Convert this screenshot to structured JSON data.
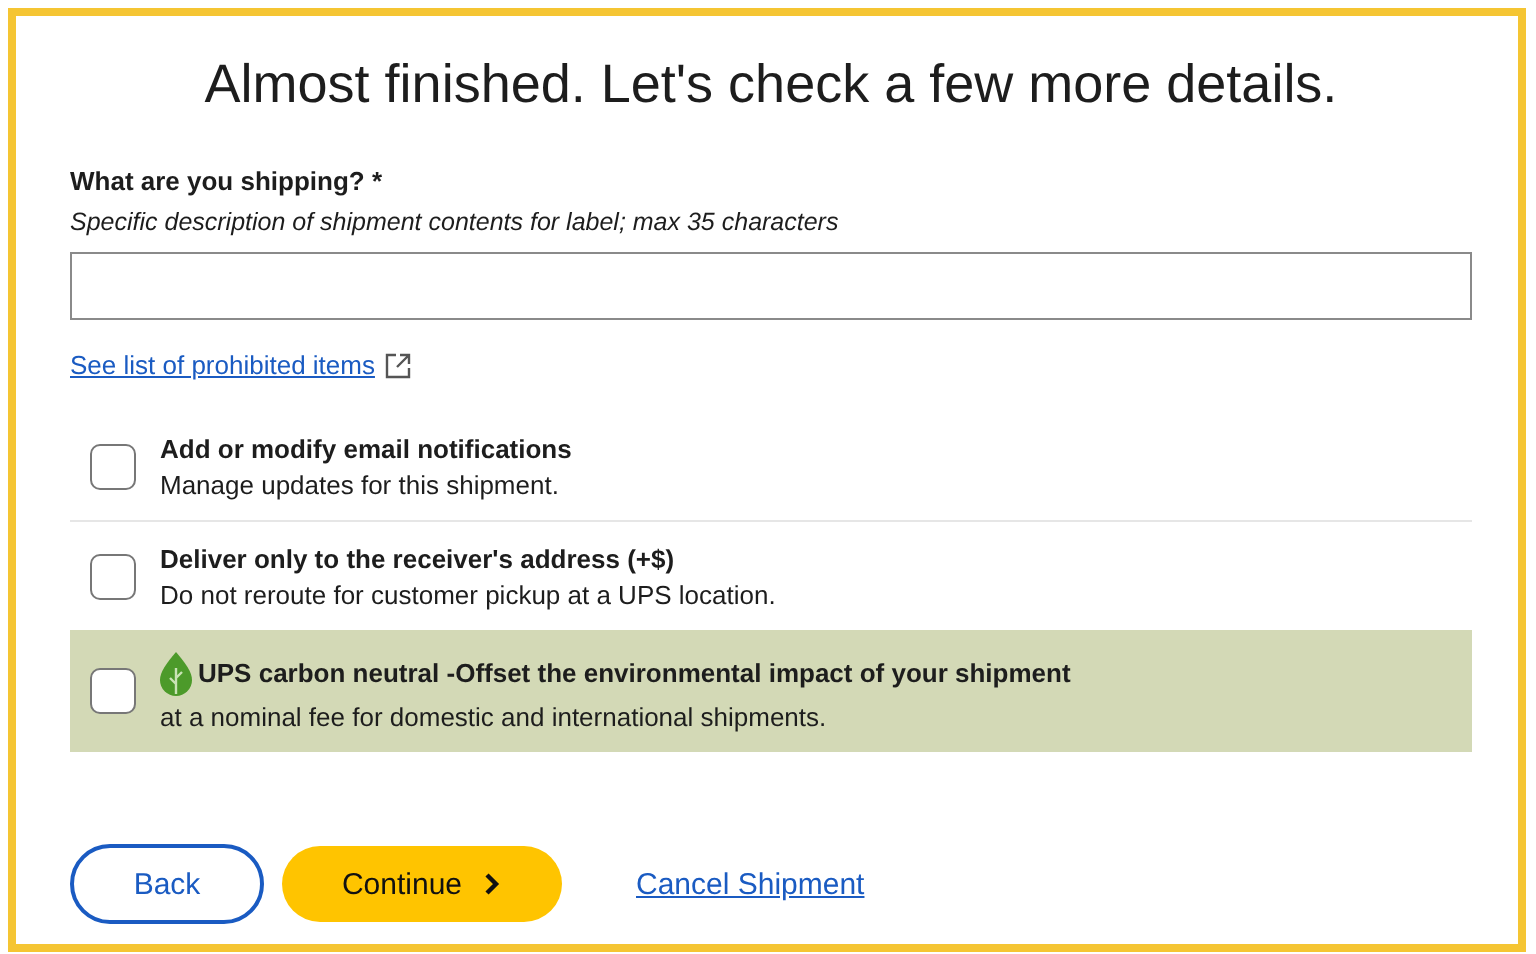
{
  "title": "Almost finished. Let's check a few more details.",
  "field": {
    "label": "What are you shipping? *",
    "hint": "Specific description of shipment contents for label; max 35 characters"
  },
  "prohibited_link": "See list of prohibited items",
  "options": [
    {
      "kind": "standard",
      "title": "Add or modify email notifications",
      "description": "Manage updates for this shipment.",
      "checked": false
    },
    {
      "kind": "standard",
      "title": "Deliver only to the receiver's address (+$)",
      "description": "Do not reroute for customer pickup at a UPS location.",
      "checked": false
    },
    {
      "kind": "eco",
      "title": "UPS carbon neutral -Offset the environmental impact of your shipment",
      "description": "at a nominal fee for domestic and international shipments.",
      "checked": false
    }
  ],
  "buttons": {
    "back": "Back",
    "continue": "Continue",
    "cancel": "Cancel Shipment"
  }
}
